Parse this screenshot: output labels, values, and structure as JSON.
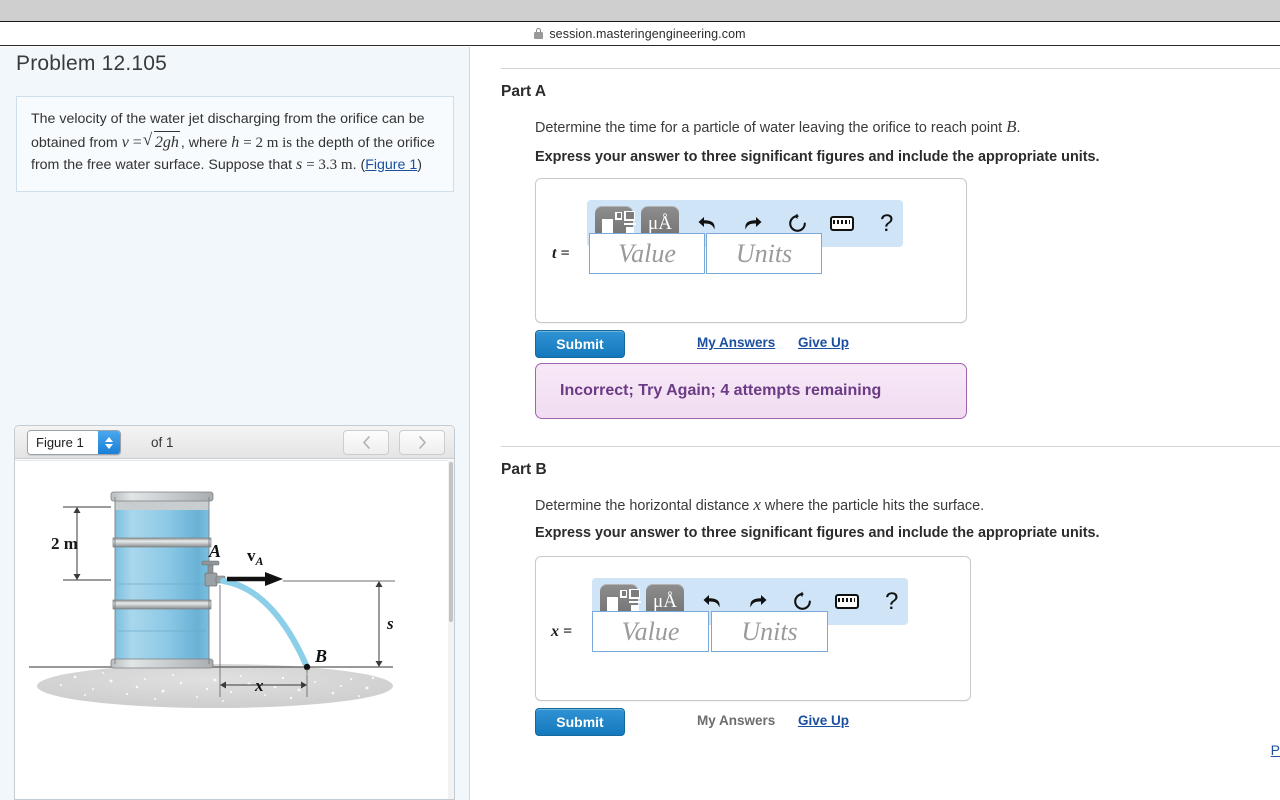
{
  "browser": {
    "url": "session.masteringengineering.com",
    "lock_icon": "lock-icon"
  },
  "left_panel": {
    "title": "Problem 12.105",
    "statement": {
      "line_1": "The velocity of the water jet discharging from the orifice",
      "line_2_a": "can be obtained from",
      "v_symbol": "v",
      "equals": "=",
      "radicand": "2gh",
      "line_2_b": ", where",
      "h_symbol": "h",
      "h_value": "= 2 m is the",
      "line_3": "depth of the orifice from the free water surface. Suppose",
      "line_4_a": "that",
      "s_symbol": "s",
      "s_value": "= 3.3  m",
      "line_4_b": ". (",
      "figure_link": "Figure 1",
      "line_4_c": ")"
    },
    "figure_nav": {
      "select_value": "Figure 1",
      "of_label": "of 1",
      "prev_icon": "chevron-left-icon",
      "next_icon": "chevron-right-icon"
    },
    "figure": {
      "label_height": "2 m",
      "label_point_a": "A",
      "label_point_b": "B",
      "label_velocity": "v",
      "label_velocity_sub": "A",
      "label_s": "s",
      "label_x": "x",
      "colors": {
        "water": "#7fc0e0",
        "water_light": "#a5d3ea",
        "jet": "#8ccfe8",
        "metal": "#a8acae",
        "ground": "#d4d4d4"
      }
    }
  },
  "right_panel": {
    "parts": [
      {
        "label": "Part A",
        "question_pre": "Determine the time for a particle of water leaving the orifice to reach point ",
        "question_var": "B",
        "question_post": ".",
        "instruction": "Express your answer to three significant figures and include the appropriate units.",
        "toolbar": {
          "template_icon": "math-template-icon",
          "units_label": "μÅ",
          "undo_icon": "undo-icon",
          "redo_icon": "redo-icon",
          "reset_icon": "reset-icon",
          "keyboard_icon": "keyboard-icon",
          "help_label": "?"
        },
        "answer": {
          "var_label": "t =",
          "value_placeholder": "Value",
          "units_placeholder": "Units",
          "value": "",
          "units": ""
        },
        "submit_label": "Submit",
        "my_answers_label": "My Answers",
        "my_answers_enabled": true,
        "give_up_label": "Give Up",
        "feedback": "Incorrect; Try Again; 4 attempts remaining",
        "feedback_color": "#6b3b86"
      },
      {
        "label": "Part B",
        "question_pre": "Determine the horizontal distance ",
        "question_var": "x",
        "question_post": " where the particle hits the surface.",
        "instruction": "Express your answer to three significant figures and include the appropriate units.",
        "toolbar": {
          "template_icon": "math-template-icon",
          "units_label": "μÅ",
          "undo_icon": "undo-icon",
          "redo_icon": "redo-icon",
          "reset_icon": "reset-icon",
          "keyboard_icon": "keyboard-icon",
          "help_label": "?"
        },
        "answer": {
          "var_label": "x =",
          "value_placeholder": "Value",
          "units_placeholder": "Units",
          "value": "",
          "units": ""
        },
        "submit_label": "Submit",
        "my_answers_label": "My Answers",
        "my_answers_enabled": false,
        "give_up_label": "Give Up",
        "feedback": "",
        "feedback_color": ""
      }
    ],
    "edge_link": "P"
  },
  "theme": {
    "accent_blue": "#1478bd",
    "link_blue": "#1c4fa0",
    "toolbar_blue": "#cfe4f7",
    "panel_bg": "#f2f7fb",
    "feedback_purple": "#9f65ad"
  }
}
